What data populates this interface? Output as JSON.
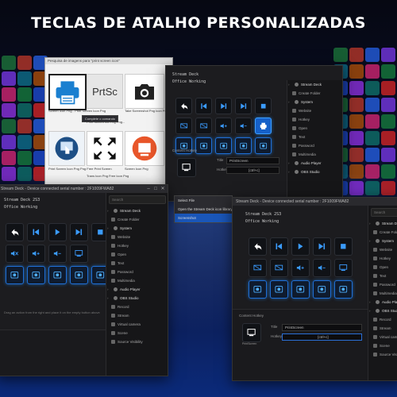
{
  "title": "TECLAS DE ATALHO PERSONALIZADAS",
  "browser": {
    "tab_text": "Pesquisa de imagens para \"print screen icon\"",
    "prtsc_label": "PrtSc",
    "context_text": "Complete o comando",
    "captions": [
      "Screen Icon Png - Print Screen Icon Png",
      "Print Screen Ico Png Png...",
      "Take Screenshot Png Icon Png",
      "Print Screen Icon Png Png Free Print Screen",
      "Trans Icon Png Free Icon Png",
      "Screen Icon Png"
    ]
  },
  "window_top": {
    "device": "Stream Deck",
    "profile": "Office Working",
    "panel_items": [
      {
        "label": "Stream Deck",
        "cat": true
      },
      {
        "label": "Create Folder",
        "cat": false
      },
      {
        "label": "System",
        "cat": true
      },
      {
        "label": "Website",
        "cat": false
      },
      {
        "label": "Hotkey",
        "cat": false
      },
      {
        "label": "Open",
        "cat": false
      },
      {
        "label": "Text",
        "cat": false
      },
      {
        "label": "Password",
        "cat": false
      },
      {
        "label": "Multimedia",
        "cat": false
      },
      {
        "label": "Audio Player",
        "cat": true
      },
      {
        "label": "OBS Studio",
        "cat": true
      }
    ],
    "bottom_label": "Content Hotkey",
    "title_label": "Title",
    "title_value": "PrintScreen",
    "hotkey_label": "Hotkey",
    "hotkey_value": "[ctrl+c]"
  },
  "context_menu": [
    {
      "label": "Select File",
      "selected": false
    },
    {
      "label": "Open the Stream Deck icon library",
      "selected": false
    },
    {
      "label": "Screenshot",
      "selected": true
    }
  ],
  "window_left": {
    "titlebar": "Stream Deck - Device connected serial number : 2F1009FWA82",
    "device": "Stream Deck 2S3",
    "profile": "Office Working",
    "search_placeholder": "Search",
    "panel_items": [
      {
        "label": "Stream Deck",
        "cat": true
      },
      {
        "label": "Create Folder",
        "cat": false
      },
      {
        "label": "System",
        "cat": true
      },
      {
        "label": "Website",
        "cat": false
      },
      {
        "label": "Hotkey",
        "cat": false
      },
      {
        "label": "Open",
        "cat": false
      },
      {
        "label": "Text",
        "cat": false
      },
      {
        "label": "Password",
        "cat": false
      },
      {
        "label": "Multimedia",
        "cat": false
      },
      {
        "label": "Audio Player",
        "cat": true
      },
      {
        "label": "OBS Studio",
        "cat": true
      },
      {
        "label": "Record",
        "cat": false
      },
      {
        "label": "Stream",
        "cat": false
      },
      {
        "label": "Virtual camera",
        "cat": false
      },
      {
        "label": "Scene",
        "cat": false
      },
      {
        "label": "Source Visibility",
        "cat": false
      }
    ],
    "hint": "Drag an action from the right and place it on the empty button above"
  },
  "window_right": {
    "titlebar": "Stream Deck - Device connected serial number : 2F1009FWA82",
    "device": "Stream Deck 2S3",
    "profile": "Office Working",
    "search_placeholder": "Search",
    "panel_items": [
      {
        "label": "Stream Deck",
        "cat": true
      },
      {
        "label": "Create Folder",
        "cat": false
      },
      {
        "label": "System",
        "cat": true
      },
      {
        "label": "Website",
        "cat": false
      },
      {
        "label": "Hotkey",
        "cat": false
      },
      {
        "label": "Open",
        "cat": false
      },
      {
        "label": "Text",
        "cat": false
      },
      {
        "label": "Password",
        "cat": false
      },
      {
        "label": "Multimedia",
        "cat": false
      },
      {
        "label": "Audio Player",
        "cat": true
      },
      {
        "label": "OBS Studio",
        "cat": true
      },
      {
        "label": "Record",
        "cat": false
      },
      {
        "label": "Stream",
        "cat": false
      },
      {
        "label": "Virtual camera",
        "cat": false
      },
      {
        "label": "Scene",
        "cat": false
      },
      {
        "label": "Source Visibility",
        "cat": false
      }
    ],
    "bottom_label": "Content Hotkey",
    "title_label": "Title",
    "title_value": "PrintScreen",
    "hotkey_label": "Hotkey",
    "hotkey_value": "[ctrl+c]",
    "key_caption": "PrintScreen"
  },
  "colors": {
    "accent": "#1f8bff",
    "window_bg": "#1c1c1f",
    "page_bg": "#060812"
  }
}
